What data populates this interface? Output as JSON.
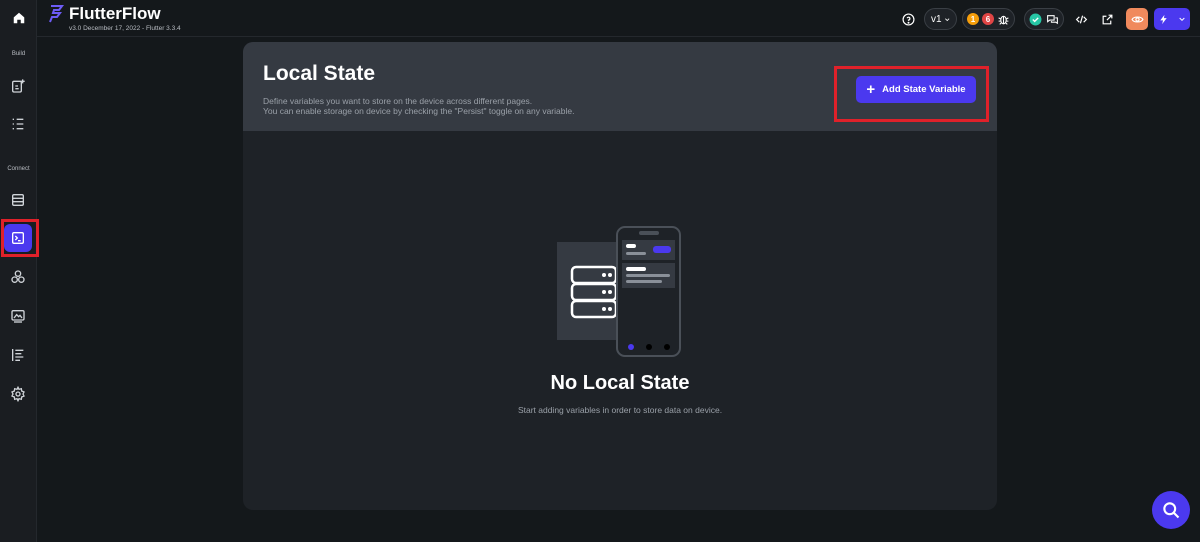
{
  "app": {
    "brand": "FlutterFlow",
    "version": "v3.0 December 17, 2022 - Flutter 3.3.4"
  },
  "rail": {
    "build_label": "Build",
    "connect_label": "Connect"
  },
  "topbar": {
    "version_select": "v1",
    "badge_warnings": "1",
    "badge_errors": "6"
  },
  "page": {
    "title": "Local State",
    "desc_line1": "Define variables you want to store on the device across different pages.",
    "desc_line2": "You can enable storage on device by checking the \"Persist\" toggle on any variable.",
    "add_button": "Add State Variable",
    "empty_title": "No Local State",
    "empty_subtitle": "Start adding variables in order to store data on device."
  },
  "colors": {
    "accent": "#4b39ef",
    "highlight": "#e0212a",
    "warning": "#f59e0b",
    "error": "#e04545",
    "success": "#26c6a5"
  }
}
